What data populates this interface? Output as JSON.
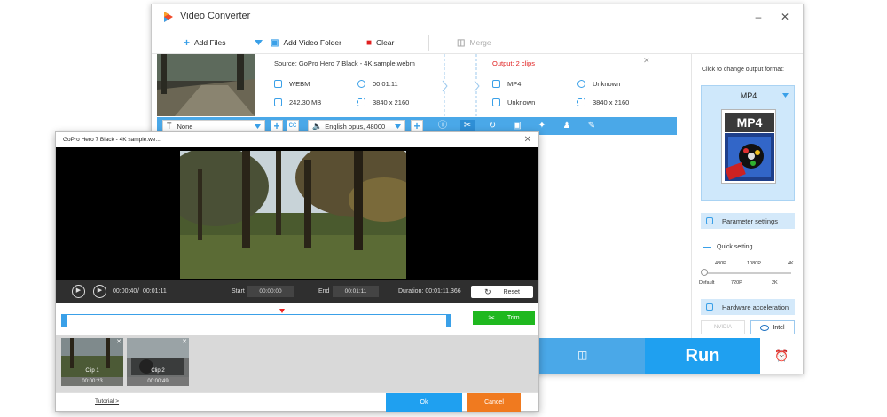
{
  "app": {
    "title": "Video Converter",
    "minimize": "–",
    "close": "✕"
  },
  "toolbar": {
    "add_files": "Add Files",
    "add_video_folder": "Add Video Folder",
    "clear": "Clear",
    "merge": "Merge"
  },
  "task": {
    "source": "Source: GoPro Hero 7 Black - 4K sample.webm",
    "output": "Output: 2 clips",
    "src_format": "WEBM",
    "src_duration": "00:01:11",
    "src_size": "242.30 MB",
    "src_resolution": "3840 x 2160",
    "out_format": "MP4",
    "out_duration": "Unknown",
    "out_size": "Unknown",
    "out_resolution": "3840 x 2160"
  },
  "edit_bar": {
    "subtitle": "None",
    "audio": "English opus, 48000"
  },
  "right_panel": {
    "change_format_label": "Click to change output format:",
    "format": "MP4",
    "format_icon_text": "MP4",
    "parameter_settings": "Parameter settings",
    "quick_setting": "Quick setting",
    "quality_top": [
      "480P",
      "1080P",
      "4K"
    ],
    "quality_bottom": [
      "Default",
      "720P",
      "2K"
    ],
    "hardware_acceleration": "Hardware acceleration",
    "nvidia": "NVIDIA",
    "intel": "Intel"
  },
  "run": {
    "label": "Run"
  },
  "dialog": {
    "title": "GoPro Hero 7 Black - 4K sample.we...",
    "current_time": "00:00:40",
    "separator": "/",
    "total_time": "00:01:11",
    "start_label": "Start",
    "start_value": "00:00:00",
    "end_label": "End",
    "end_value": "00:01:11",
    "duration": "Duration: 00:01:11.366",
    "reset": "Reset",
    "trim": "Trim",
    "clips": [
      {
        "name": "Clip 1",
        "duration": "00:00:23"
      },
      {
        "name": "Clip 2",
        "duration": "00:00:49"
      }
    ],
    "tutorial": "Tutorial >",
    "ok": "Ok",
    "cancel": "Cancel"
  },
  "colors": {
    "accent": "#4aa8e8",
    "run": "#1fa0f0",
    "output_red": "#e02020",
    "trim_green": "#1fb81f",
    "cancel_orange": "#f07a1f"
  }
}
